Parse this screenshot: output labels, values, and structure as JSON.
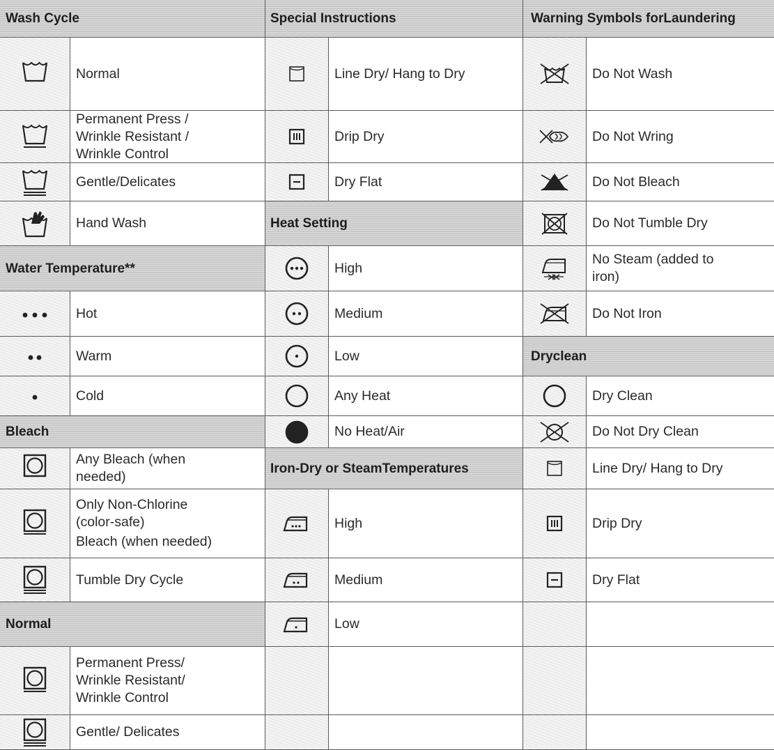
{
  "col1": {
    "wash_cycle": {
      "header": "Wash Cycle",
      "rows": [
        {
          "icon": "wash-tub-icon",
          "label": "Normal"
        },
        {
          "icon": "wash-tub-one-bar-icon",
          "label": [
            "Permanent Press /",
            "Wrinkle Resistant /",
            "Wrinkle Control"
          ]
        },
        {
          "icon": "wash-tub-two-bars-icon",
          "label": "Gentle/Delicates"
        },
        {
          "icon": "hand-wash-icon",
          "label": "Hand Wash"
        }
      ]
    },
    "water_temperature": {
      "header": "Water Temperature**",
      "rows": [
        {
          "icon": "three-dots-icon",
          "label": "Hot"
        },
        {
          "icon": "two-dots-icon",
          "label": "Warm"
        },
        {
          "icon": "one-dot-icon",
          "label": "Cold"
        }
      ]
    },
    "bleach": {
      "header": "Bleach",
      "rows": [
        {
          "icon": "tumble-dry-icon",
          "label": [
            "Any Bleach (when",
            "needed)"
          ]
        },
        {
          "icon": "tumble-dry-one-bar-icon",
          "label": [
            "Only Non-Chlorine",
            "(color-safe)",
            "Bleach (when needed)"
          ]
        },
        {
          "icon": "tumble-dry-two-bars-icon",
          "label": "Tumble Dry Cycle"
        }
      ]
    },
    "normal": {
      "header": "Normal",
      "rows": [
        {
          "icon": "tumble-dry-one-bar-icon",
          "label": [
            "Permanent Press/",
            "Wrinkle Resistant/",
            "Wrinkle Control"
          ]
        },
        {
          "icon": "tumble-dry-two-bars-icon",
          "label": "Gentle/ Delicates"
        }
      ]
    }
  },
  "col2": {
    "special_instructions": {
      "header": "Special Instructions",
      "rows": [
        {
          "icon": "line-dry-icon",
          "label": "Line Dry/ Hang to Dry"
        },
        {
          "icon": "drip-dry-icon",
          "label": "Drip Dry"
        },
        {
          "icon": "dry-flat-icon",
          "label": "Dry Flat"
        }
      ]
    },
    "heat_setting": {
      "header": "Heat Setting",
      "rows": [
        {
          "icon": "circle-three-dots-icon",
          "label": "High"
        },
        {
          "icon": "circle-two-dots-icon",
          "label": "Medium"
        },
        {
          "icon": "circle-one-dot-icon",
          "label": "Low"
        },
        {
          "icon": "circle-icon",
          "label": "Any Heat"
        },
        {
          "icon": "filled-circle-icon",
          "label": "No Heat/Air"
        }
      ]
    },
    "iron": {
      "header": [
        "Iron-Dry or Steam",
        "Temperatures"
      ],
      "rows": [
        {
          "icon": "iron-three-dots-icon",
          "label": "High"
        },
        {
          "icon": "iron-two-dots-icon",
          "label": "Medium"
        },
        {
          "icon": "iron-one-dot-icon",
          "label": "Low"
        }
      ]
    }
  },
  "col3": {
    "warning": {
      "header": [
        "Warning Symbols for",
        "Laundering"
      ],
      "rows": [
        {
          "icon": "do-not-wash-icon",
          "label": "Do Not Wash"
        },
        {
          "icon": "do-not-wring-icon",
          "label": "Do Not Wring"
        },
        {
          "icon": "do-not-bleach-icon",
          "label": "Do Not Bleach"
        },
        {
          "icon": "do-not-tumble-dry-icon",
          "label": "Do Not Tumble Dry"
        },
        {
          "icon": "no-steam-icon",
          "label": [
            "No Steam (added to",
            "iron)"
          ]
        },
        {
          "icon": "do-not-iron-icon",
          "label": "Do Not Iron"
        }
      ]
    },
    "dryclean": {
      "header": "Dryclean",
      "rows": [
        {
          "icon": "circle-icon",
          "label": "Dry Clean"
        },
        {
          "icon": "do-not-dry-clean-icon",
          "label": "Do Not Dry Clean"
        },
        {
          "icon": "line-dry-icon",
          "label": "Line Dry/ Hang to Dry"
        },
        {
          "icon": "drip-dry-icon",
          "label": "Drip Dry"
        },
        {
          "icon": "dry-flat-icon",
          "label": "Dry Flat"
        }
      ]
    }
  }
}
